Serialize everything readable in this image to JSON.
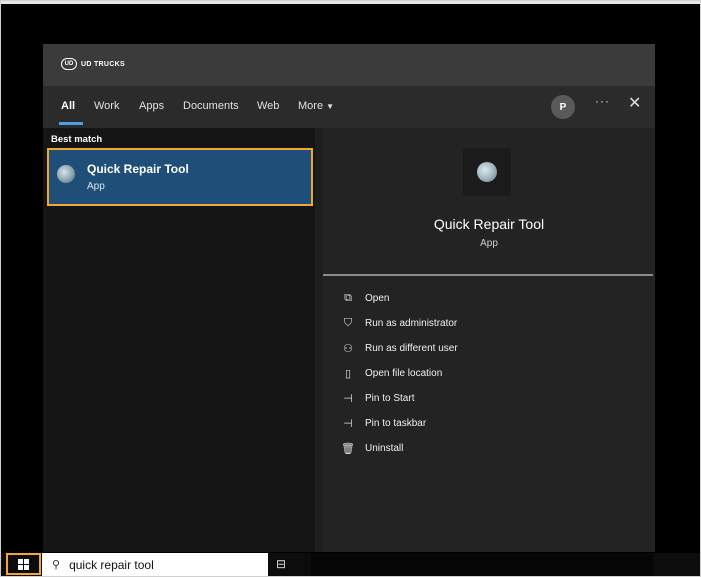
{
  "brand": {
    "name": "UD TRUCKS",
    "mark": "UD"
  },
  "tabs": [
    {
      "label": "All"
    },
    {
      "label": "Work"
    },
    {
      "label": "Apps"
    },
    {
      "label": "Documents"
    },
    {
      "label": "Web"
    },
    {
      "label": "More"
    }
  ],
  "header": {
    "avatar_initial": "P",
    "more_options": "···",
    "close": "✕"
  },
  "results": {
    "section_label": "Best match",
    "best": {
      "title": "Quick Repair Tool",
      "subtitle": "App"
    }
  },
  "details": {
    "title": "Quick Repair Tool",
    "subtitle": "App",
    "actions": [
      {
        "label": "Open",
        "icon": "open-icon"
      },
      {
        "label": "Run as administrator",
        "icon": "shield-run-icon"
      },
      {
        "label": "Run as different user",
        "icon": "user-run-icon"
      },
      {
        "label": "Open file location",
        "icon": "folder-icon"
      },
      {
        "label": "Pin to Start",
        "icon": "pin-icon"
      },
      {
        "label": "Pin to taskbar",
        "icon": "pin-icon"
      },
      {
        "label": "Uninstall",
        "icon": "trash-icon"
      }
    ]
  },
  "taskbar": {
    "search_value": "quick repair tool"
  },
  "colors": {
    "accent": "#4aa0e6",
    "highlight_border": "#f0a830",
    "selected_bg": "#1f4f78"
  }
}
